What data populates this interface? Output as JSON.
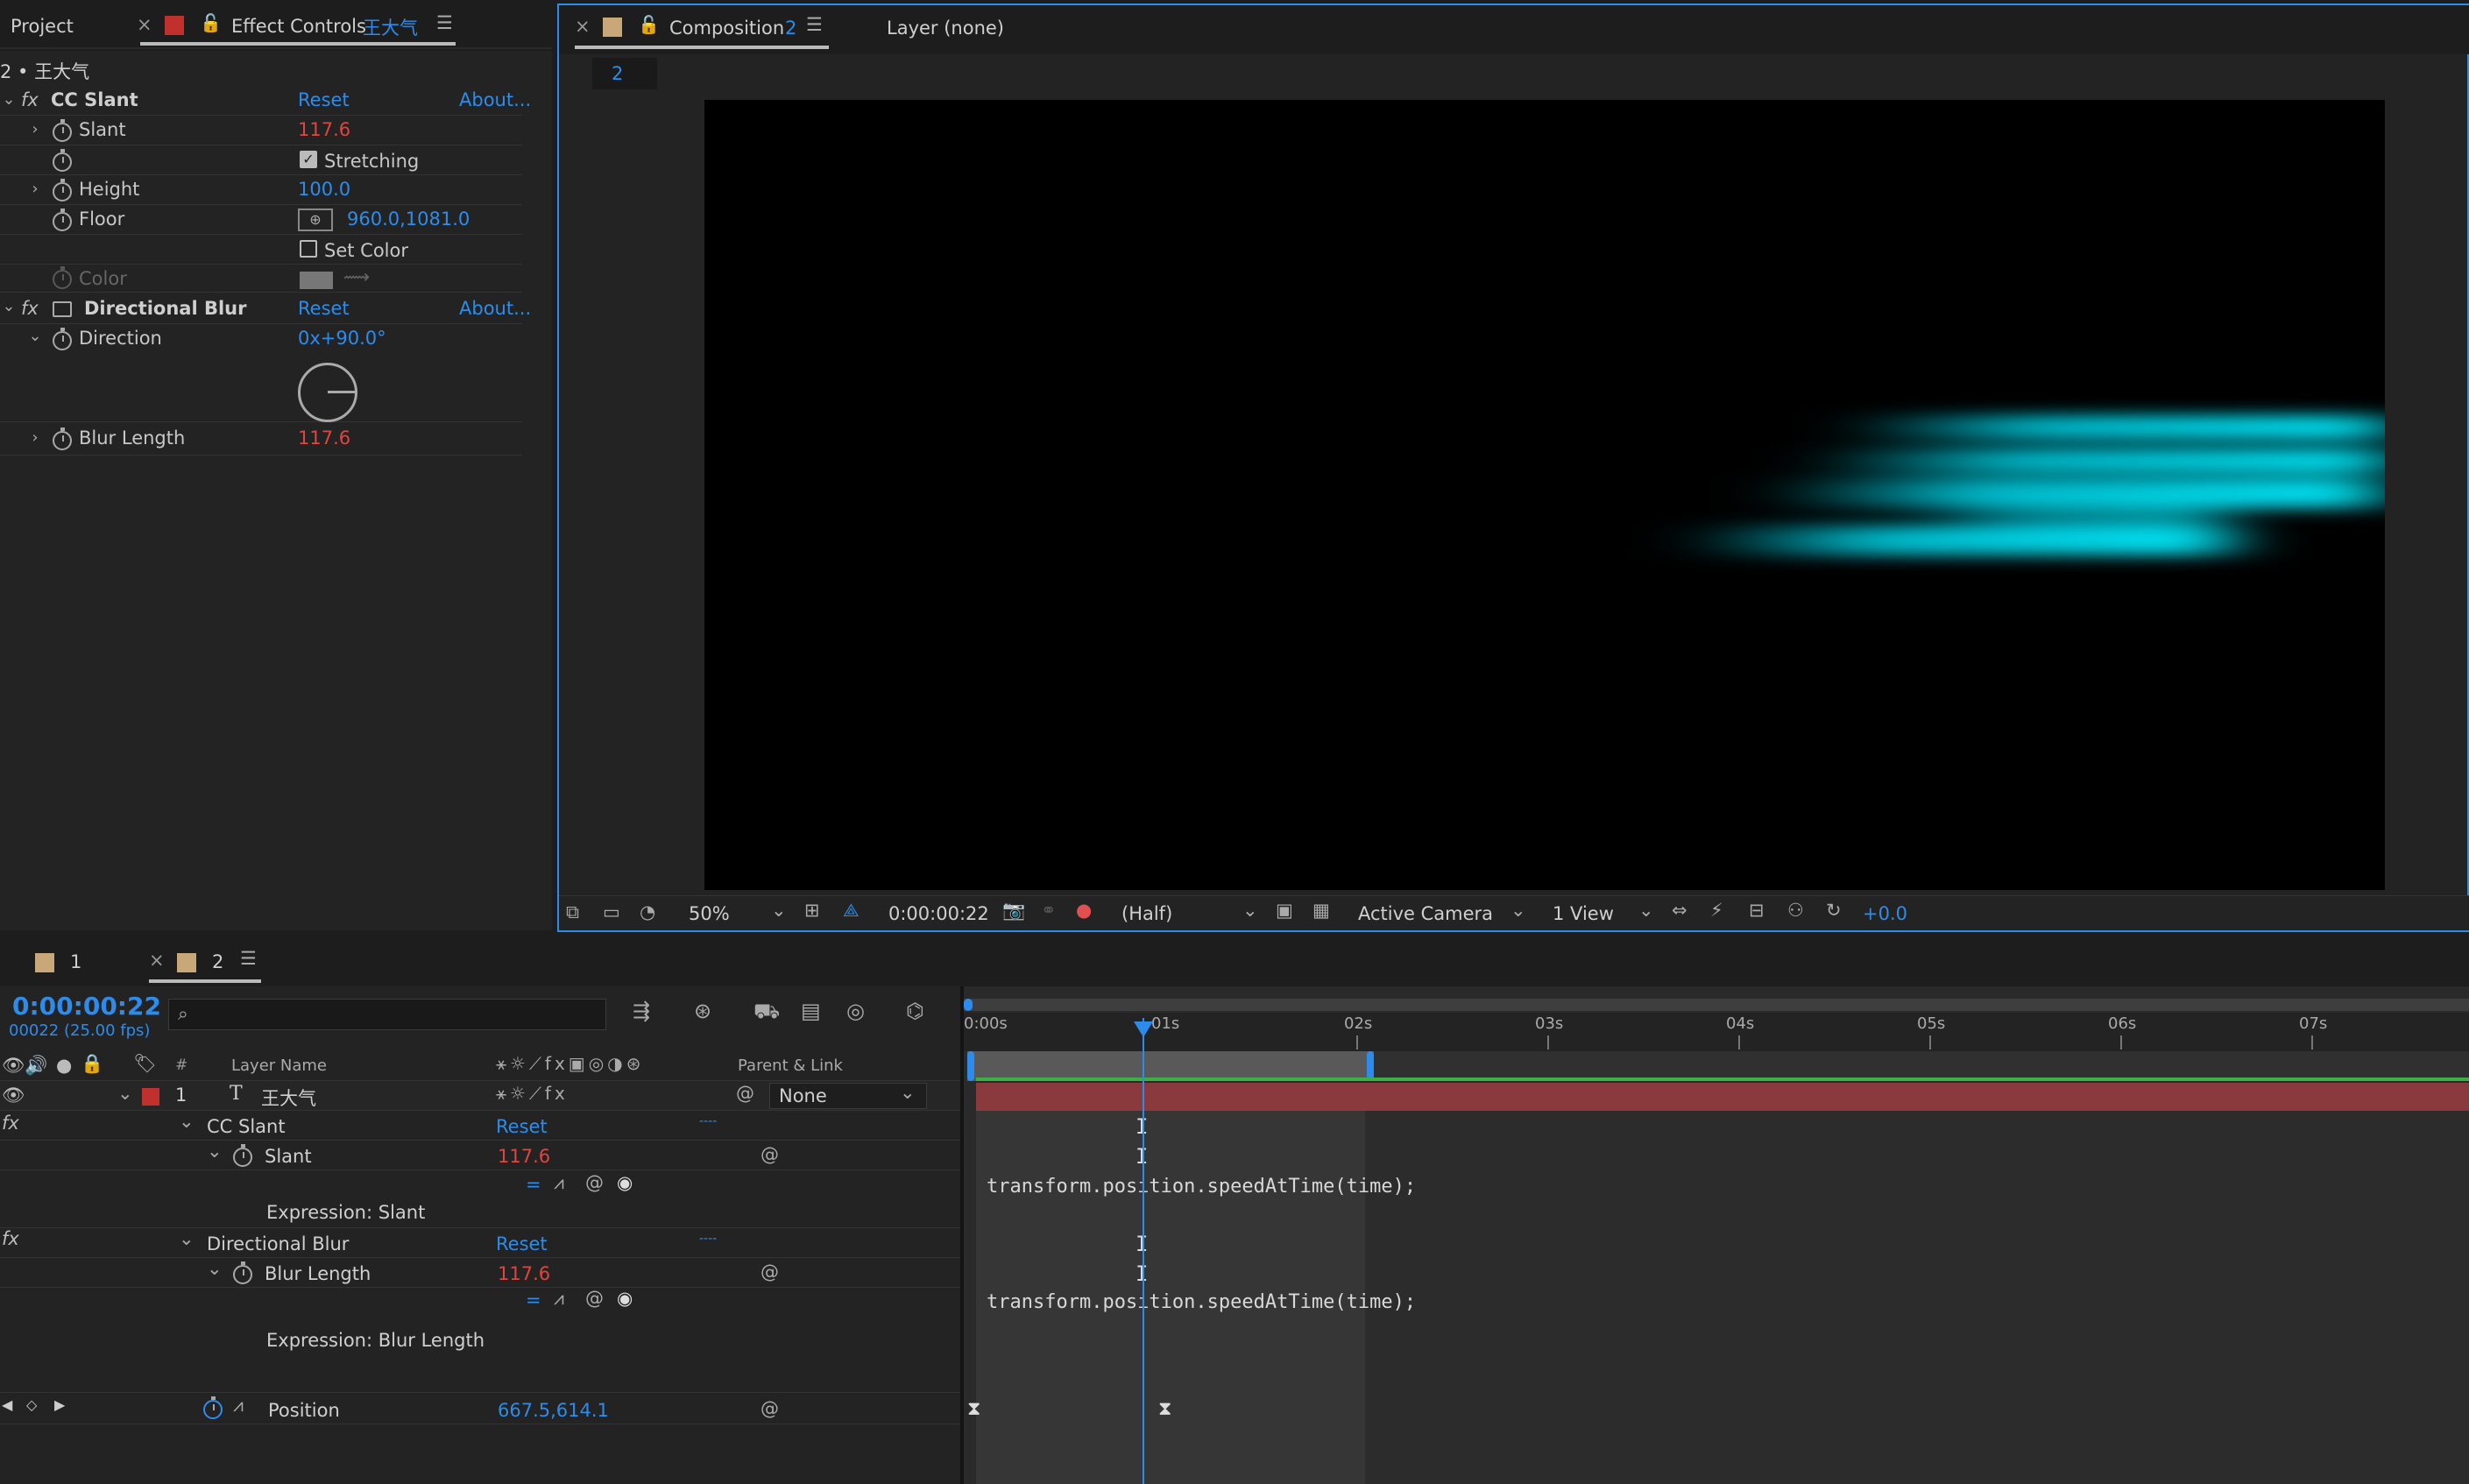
{
  "effect_panel": {
    "tab_project": "Project",
    "tab_effect_controls": "Effect Controls",
    "tab_layer_name": "王大气",
    "breadcrumb": "2 • 王大气",
    "effects": [
      {
        "name": "CC Slant",
        "reset": "Reset",
        "about": "About...",
        "props": [
          {
            "label": "Slant",
            "value": "117.6",
            "color": "red"
          },
          {
            "label": "",
            "checkbox_label": "Stretching",
            "checked": true
          },
          {
            "label": "Height",
            "value": "100.0",
            "color": "blue"
          },
          {
            "label": "Floor",
            "value": "960.0,1081.0",
            "color": "blue"
          },
          {
            "label": "",
            "checkbox_label": "Set Color",
            "checked": false
          },
          {
            "label": "Color",
            "disabled": true
          }
        ]
      },
      {
        "name": "Directional Blur",
        "reset": "Reset",
        "about": "About...",
        "props": [
          {
            "label": "Direction",
            "value": "0x+90.0°",
            "color": "blue"
          },
          {
            "label": "Blur Length",
            "value": "117.6",
            "color": "red"
          }
        ]
      }
    ]
  },
  "comp_panel": {
    "tab_composition": "Composition",
    "tab_comp_name": "2",
    "tab_layer": "Layer (none)",
    "comp_breadcrumb": "2",
    "toolbar": {
      "zoom": "50%",
      "timecode": "0:00:00:22",
      "resolution": "(Half)",
      "camera": "Active Camera",
      "views": "1 View",
      "exposure": "+0.0"
    }
  },
  "timeline": {
    "tab_1": "1",
    "tab_2": "2",
    "current_time": "0:00:00:22",
    "frame_info": "00022 (25.00 fps)",
    "search_placeholder": "",
    "col_number": "#",
    "col_layer_name": "Layer Name",
    "col_parent": "Parent & Link",
    "layer": {
      "index": "1",
      "type_icon": "T",
      "name": "王大气",
      "parent": "None"
    },
    "rows": {
      "cc_slant": "CC Slant",
      "cc_slant_reset": "Reset",
      "cc_slant_dots": "----",
      "slant": "Slant",
      "slant_value": "117.6",
      "expr_slant_label": "Expression: Slant",
      "dir_blur": "Directional Blur",
      "dir_blur_reset": "Reset",
      "dir_blur_dots": "----",
      "blur_length": "Blur Length",
      "blur_length_value": "117.6",
      "expr_blur_label": "Expression: Blur Length",
      "position": "Position",
      "position_value": "667.5,614.1"
    },
    "expression_text": "transform.position.speedAtTime(time);",
    "ruler_labels": [
      "0:00s",
      "01s",
      "02s",
      "03s",
      "04s",
      "05s",
      "06s",
      "07s"
    ]
  },
  "colors": {
    "accent": "#2d8ceb",
    "value_red": "#e0453f",
    "layer_bar": "#8a3a3c",
    "label_red": "#c0302c",
    "cyan_streak": "#00d8ec"
  }
}
